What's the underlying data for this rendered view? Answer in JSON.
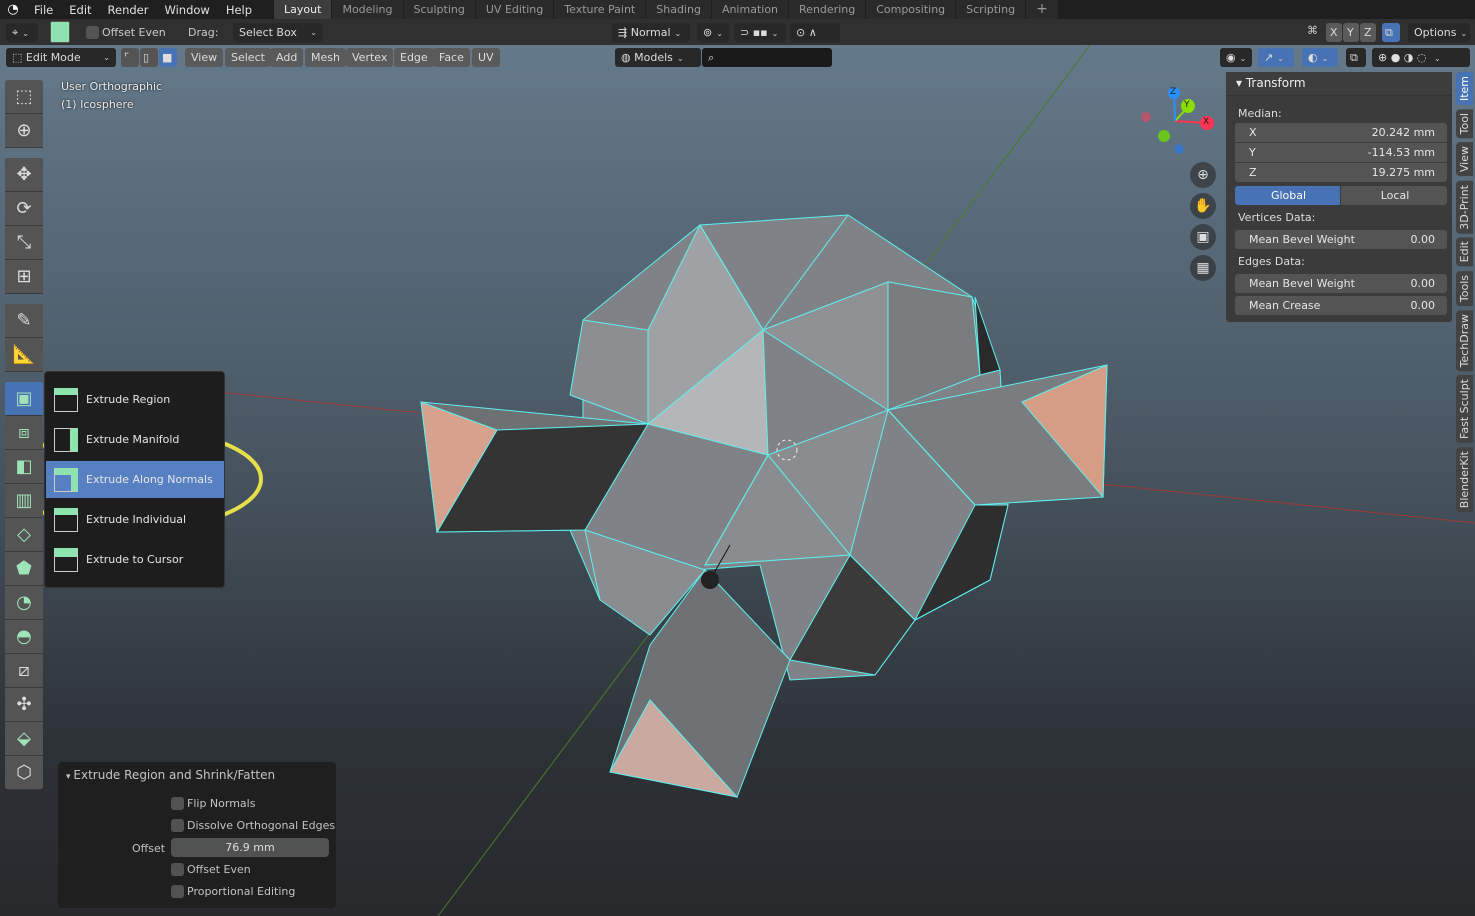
{
  "topbar": {
    "menus": [
      "File",
      "Edit",
      "Render",
      "Window",
      "Help"
    ],
    "workspaces": [
      "Layout",
      "Modeling",
      "Sculpting",
      "UV Editing",
      "Texture Paint",
      "Shading",
      "Animation",
      "Rendering",
      "Compositing",
      "Scripting"
    ],
    "active_workspace": "Layout",
    "add_tab": "+"
  },
  "tool_header": {
    "offset_even": "Offset Even",
    "drag_label": "Drag:",
    "drag_value": "Select Box",
    "orientation": "Normal",
    "axes": [
      "X",
      "Y",
      "Z"
    ],
    "options": "Options"
  },
  "viewport_header": {
    "mode": "Edit Mode",
    "menus": [
      "View",
      "Select",
      "Add",
      "Mesh",
      "Vertex",
      "Edge",
      "Face",
      "UV"
    ],
    "collection": "Models",
    "search_value": ""
  },
  "viewport": {
    "view_name": "User Orthographic",
    "object_name": "(1) Icosphere",
    "gizmo": {
      "x": "X",
      "y": "Y",
      "z": "Z"
    },
    "colors": {
      "axis_x": "#ff3352",
      "axis_y": "#8bdc00",
      "axis_z": "#2890ff",
      "edge_select": "#5ff0f0",
      "face_select": "#d9a48c",
      "annotation": "#e5e04a"
    }
  },
  "flyout": {
    "items": [
      {
        "label": "Extrude Region",
        "icon": "extrude-region-icon"
      },
      {
        "label": "Extrude Manifold",
        "icon": "extrude-manifold-icon"
      },
      {
        "label": "Extrude Along Normals",
        "icon": "extrude-along-normals-icon",
        "selected": true
      },
      {
        "label": "Extrude Individual",
        "icon": "extrude-individual-icon"
      },
      {
        "label": "Extrude to Cursor",
        "icon": "extrude-to-cursor-icon"
      }
    ]
  },
  "n_panel": {
    "title": "Transform",
    "median_label": "Median:",
    "x": {
      "label": "X",
      "value": "20.242 mm"
    },
    "y": {
      "label": "Y",
      "value": "-114.53 mm"
    },
    "z": {
      "label": "Z",
      "value": "19.275 mm"
    },
    "global": "Global",
    "local": "Local",
    "space_selected": "Global",
    "vertices_label": "Vertices Data:",
    "v_bevel": {
      "label": "Mean Bevel Weight",
      "value": "0.00"
    },
    "edges_label": "Edges Data:",
    "e_bevel": {
      "label": "Mean Bevel Weight",
      "value": "0.00"
    },
    "e_crease": {
      "label": "Mean Crease",
      "value": "0.00"
    }
  },
  "sidebar_tabs": [
    "Item",
    "Tool",
    "View",
    "3D-Print",
    "Edit",
    "Tools",
    "TechDraw",
    "Fast Sculpt",
    "BlenderKit"
  ],
  "operator_panel": {
    "title": "Extrude Region and Shrink/Fatten",
    "flip_normals": "Flip Normals",
    "dissolve": "Dissolve Orthogonal Edges",
    "offset_label": "Offset",
    "offset_value": "76.9 mm",
    "offset_even": "Offset Even",
    "proportional": "Proportional Editing"
  }
}
